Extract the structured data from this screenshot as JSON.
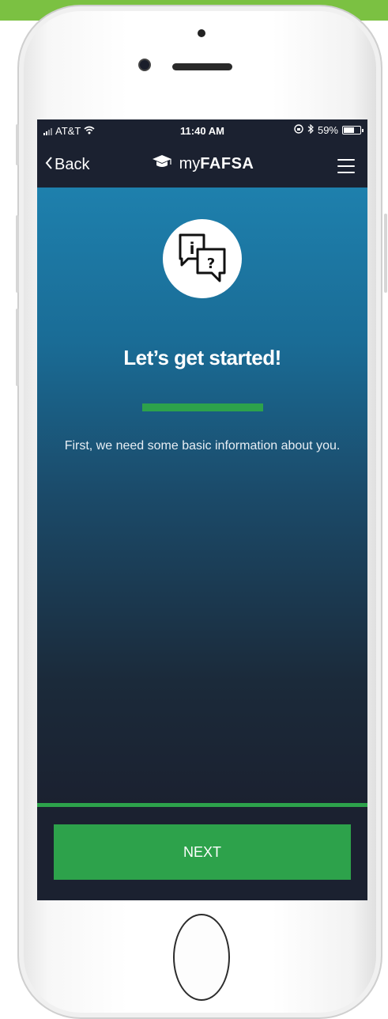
{
  "status_bar": {
    "carrier": "AT&T",
    "time": "11:40 AM",
    "battery": "59%",
    "battery_level": 0.59
  },
  "nav": {
    "back_label": "Back",
    "brand_prefix": "my",
    "brand_bold": "FAFSA"
  },
  "main": {
    "headline": "Let’s get started!",
    "subtext": "First, we need some basic information about you.",
    "icon_info_glyph": "i",
    "icon_question_glyph": "?"
  },
  "footer": {
    "next_label": "NEXT"
  },
  "colors": {
    "accent_green": "#2da24b",
    "nav_dark": "#1b2130",
    "gradient_top": "#1e80ad"
  },
  "icons": [
    "signal-icon",
    "wifi-icon",
    "rotation-lock-icon",
    "bluetooth-icon",
    "battery-icon",
    "chevron-left-icon",
    "graduation-cap-icon",
    "hamburger-menu-icon",
    "info-question-chat-icon"
  ]
}
